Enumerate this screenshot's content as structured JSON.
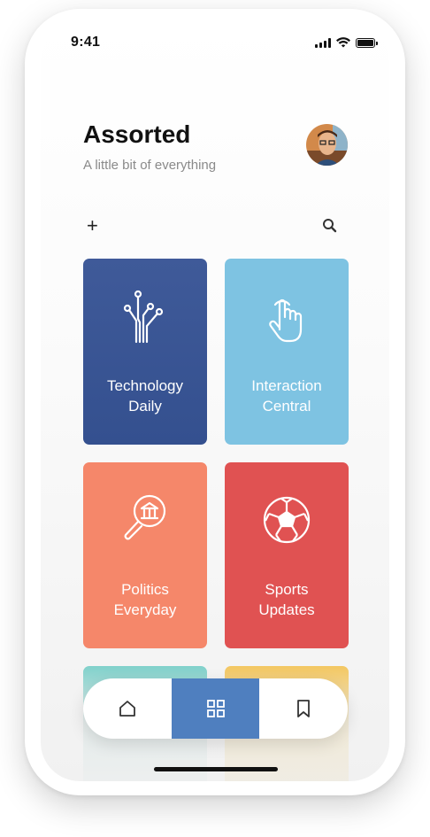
{
  "status_bar": {
    "time": "9:41",
    "signal_icon": "cellular-signal-icon",
    "wifi_icon": "wifi-icon",
    "battery_icon": "battery-icon"
  },
  "header": {
    "title": "Assorted",
    "subtitle": "A little bit of everything",
    "avatar_icon": "user-avatar"
  },
  "toolbar": {
    "add_label": "+",
    "add_icon": "plus-icon",
    "search_icon": "search-icon"
  },
  "cards": [
    {
      "label_line1": "Technology",
      "label_line2": "Daily",
      "icon": "circuit-icon",
      "color": "#3a5594"
    },
    {
      "label_line1": "Interaction",
      "label_line2": "Central",
      "icon": "hand-pointer-icon",
      "color": "#7ec3e2"
    },
    {
      "label_line1": "Politics",
      "label_line2": "Everyday",
      "icon": "magnifier-government-icon",
      "color": "#f5876a"
    },
    {
      "label_line1": "Sports",
      "label_line2": "Updates",
      "icon": "soccer-ball-icon",
      "color": "#e05252"
    },
    {
      "icon": "",
      "color": "#80d1cb"
    },
    {
      "icon": "",
      "color": "#f3c761"
    }
  ],
  "tabbar": {
    "tabs": [
      {
        "name": "home",
        "icon": "home-icon"
      },
      {
        "name": "grid",
        "icon": "grid-icon",
        "active": true
      },
      {
        "name": "bookmarks",
        "icon": "bookmark-icon"
      }
    ],
    "active_color": "#4f7fbf"
  }
}
